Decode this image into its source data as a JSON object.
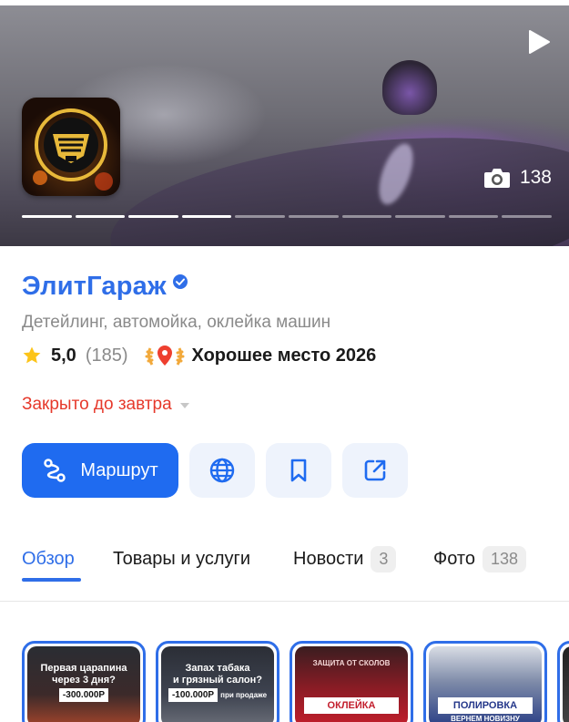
{
  "hero": {
    "photo_count": "138",
    "progress_segments": 10,
    "progress_done": 4
  },
  "org": {
    "name": "ЭлитГараж",
    "category": "Детейлинг, автомойка, оклейка машин",
    "rating": "5,0",
    "reviews_count": "(185)",
    "award": "Хорошее место 2026",
    "hours_status": "Закрыто до завтра"
  },
  "actions": {
    "route_label": "Маршрут",
    "website_icon": "globe-icon",
    "bookmark_icon": "bookmark-icon",
    "share_icon": "share-icon"
  },
  "tabs": [
    {
      "label": "Обзор",
      "badge": "",
      "active": true
    },
    {
      "label": "Товары и услуги",
      "badge": "",
      "active": false
    },
    {
      "label": "Новости",
      "badge": "3",
      "active": false
    },
    {
      "label": "Фото",
      "badge": "138",
      "active": false
    }
  ],
  "stories": [
    {
      "line1": "Первая царапина",
      "line2": "через 3 дня?",
      "tag": "-300.000Р"
    },
    {
      "line1": "Запах табака",
      "line2": "и грязный салон?",
      "tag": "-100.000Р",
      "tag_suffix": "при продаже"
    },
    {
      "banner": "ОКЛЕЙКА",
      "sub": "ЗАЩИТА ОТ СКОЛОВ"
    },
    {
      "banner": "ПОЛИРОВКА",
      "sub": "ВЕРНЕМ НОВИЗНУ"
    }
  ],
  "colors": {
    "accent": "#2f6ee8",
    "route_button": "#1f6bf0",
    "closed": "#e6392b",
    "secondary_text": "#8a8a8a",
    "star": "#fcc419"
  }
}
